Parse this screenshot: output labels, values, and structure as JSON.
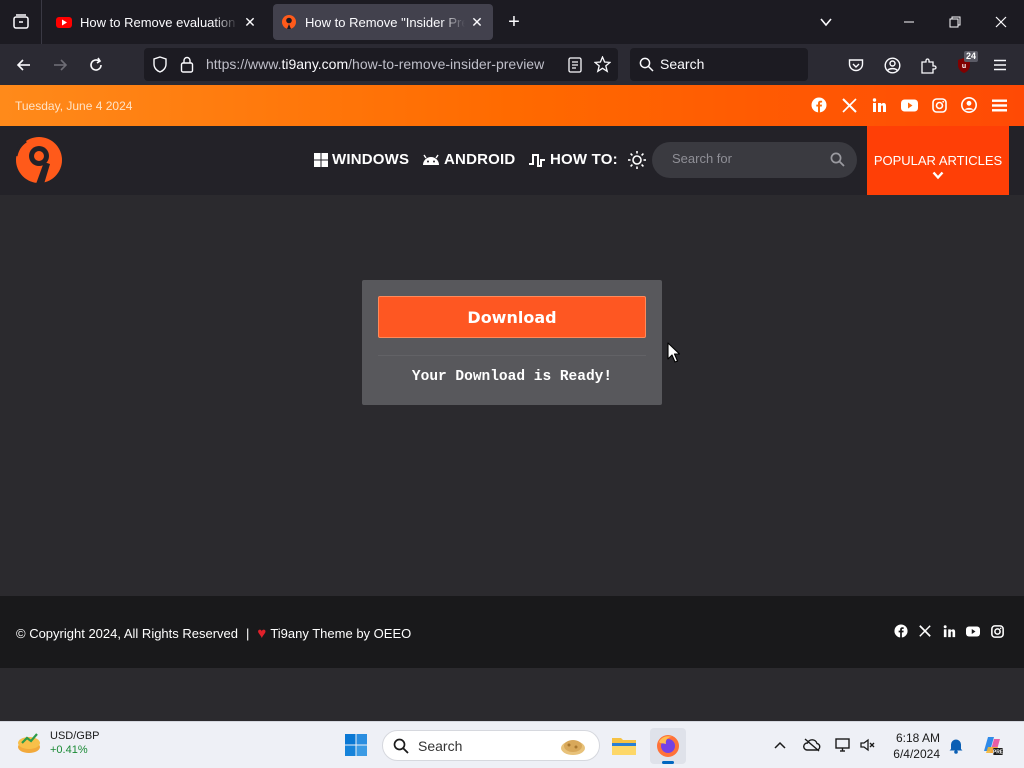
{
  "browser": {
    "tabs": [
      {
        "title": "How to Remove evaluation copy",
        "favicon": "youtube-icon",
        "active": false
      },
      {
        "title": "How to Remove \"Insider Preview\"",
        "favicon": "ti9any-icon",
        "active": true
      }
    ],
    "url_prefix": "https://www.",
    "url_host": "ti9any.com",
    "url_path": "/how-to-remove-insider-preview",
    "search_placeholder": "Search",
    "extension_badge": "24"
  },
  "site": {
    "date": "Tuesday, June 4 2024",
    "social_icons": [
      "facebook-icon",
      "x-icon",
      "linkedin-icon",
      "youtube-icon",
      "instagram-icon",
      "user-icon",
      "menu-icon"
    ],
    "menu": [
      {
        "label": "WINDOWS",
        "icon": "windows-icon"
      },
      {
        "label": "ANDROID",
        "icon": "android-icon"
      },
      {
        "label": "HOW TO:",
        "icon": "howto-icon"
      }
    ],
    "search_placeholder": "Search for",
    "popular_label": "POPULAR ARTICLES",
    "brand_color": "#ff5722"
  },
  "download": {
    "button_label": "Download",
    "status": "Your Download is Ready!"
  },
  "footer": {
    "copyright": "© Copyright 2024, All Rights Reserved",
    "separator": "|",
    "heart": "♥",
    "theme_credit": "Ti9any Theme by OEEO",
    "social_icons": [
      "facebook-icon",
      "x-icon",
      "linkedin-icon",
      "youtube-icon",
      "instagram-icon"
    ]
  },
  "taskbar": {
    "widget_pair": "USD/GBP",
    "widget_change": "+0.41%",
    "search_placeholder": "Search",
    "time": "6:18 AM",
    "date": "6/4/2024"
  }
}
